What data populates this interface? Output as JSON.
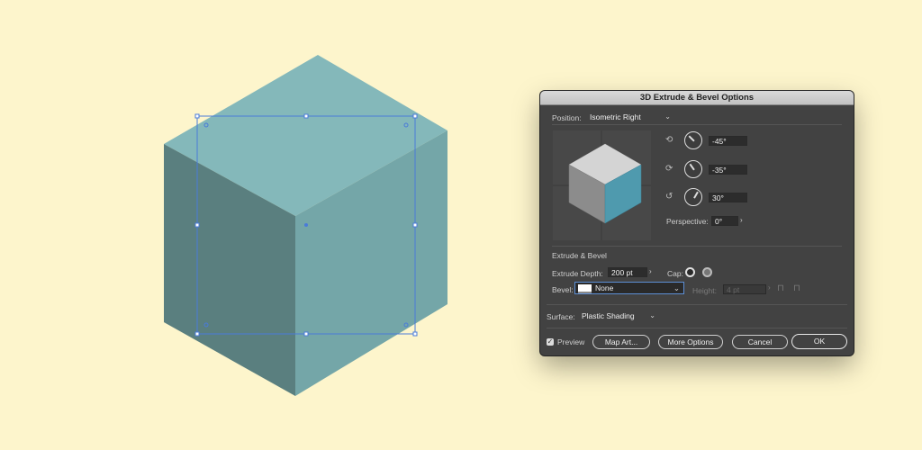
{
  "dialog": {
    "title": "3D Extrude & Bevel Options",
    "position_label": "Position:",
    "position_value": "Isometric Right",
    "rotation_x": "-45°",
    "rotation_y": "-35°",
    "rotation_z": "30°",
    "perspective_label": "Perspective:",
    "perspective_value": "0°",
    "extrude_section_label": "Extrude & Bevel",
    "extrude_depth_label": "Extrude Depth:",
    "extrude_depth_value": "200 pt",
    "cap_label": "Cap:",
    "bevel_label": "Bevel:",
    "bevel_value": "None",
    "height_label": "Height:",
    "height_value": "4 pt",
    "surface_label": "Surface:",
    "surface_value": "Plastic Shading",
    "preview_label": "Preview",
    "preview_checked": true,
    "buttons": {
      "map_art": "Map Art...",
      "more_options": "More Options",
      "cancel": "Cancel",
      "ok": "OK"
    }
  },
  "colors": {
    "background": "#fdf5cc",
    "cube_top": "#84b8ba",
    "cube_left": "#5a7f7f",
    "cube_right": "#74a6a8",
    "selection": "#4a7bd8",
    "preview_top": "#d4d4d4",
    "preview_left": "#8c8c8c",
    "preview_right": "#4f9aae"
  }
}
